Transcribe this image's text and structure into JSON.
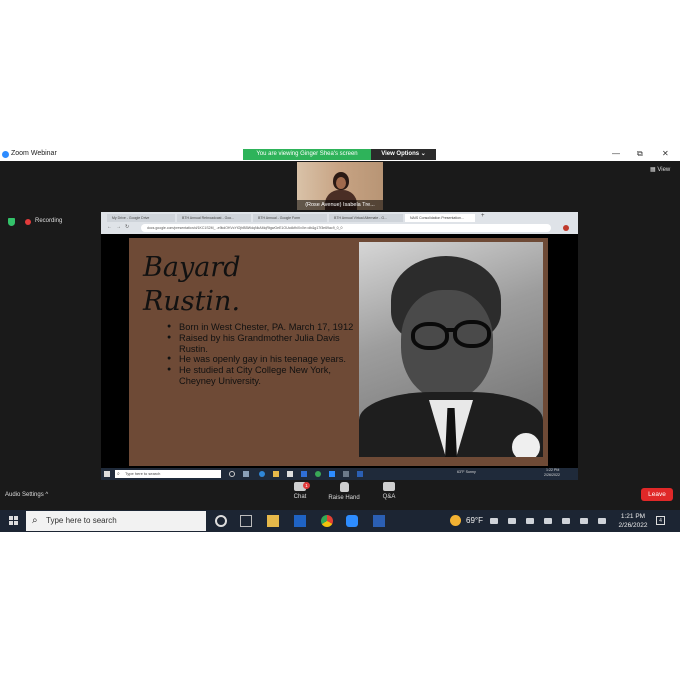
{
  "zoom": {
    "title": "Zoom Webinar",
    "banner": "You are viewing Ginger Shea's screen",
    "view_options": "View Options",
    "view_options_arrow": "⌄",
    "view_label": "View",
    "recording": "Recording",
    "participant_name": "(Rose Avenue) Isabela Tre...",
    "audio_settings": "Audio Settings",
    "audio_caret": "^",
    "controls": {
      "chat": "Chat",
      "chat_badge": "1",
      "raise_hand": "Raise Hand",
      "qa": "Q&A"
    },
    "leave": "Leave",
    "window_controls": {
      "minimize": "—",
      "restore": "⧉",
      "close": "✕"
    }
  },
  "browser": {
    "tabs": [
      "My Drive - Google Drive",
      "BTH Annual Rebroadcast - Goo...",
      "BTH Annual - Google Form",
      "BTH Annual Virtual Alternate - G...",
      "NAIS Consolidation Presentation..."
    ],
    "new_tab": "+",
    "url": "docs.google.com/presentation/d/1KC1S2M_ -e9kdOHVcYlOjhBBWdqNkAMqRtgwGeE1OUcdkfhiXxXe=db&g17f3e69ac9_0_0"
  },
  "slide": {
    "title_line1": "Bayard",
    "title_line2": "Rustin.",
    "bullets": [
      "Born in West Chester, PA. March 17, 1912",
      "Raised by his Grandmother Julia Davis Rustin.",
      "He was openly gay in his teenage years.",
      "He studied at City College New York, Cheyney University."
    ]
  },
  "inner_taskbar": {
    "search": "Type here to search",
    "weather": "63°F Sunny",
    "time": "1:22 PM",
    "date": "2/26/2022"
  },
  "taskbar": {
    "search_placeholder": "Type here to search",
    "temperature": "69°F",
    "time": "1:21 PM",
    "date": "2/26/2022",
    "notification_count": "4"
  },
  "colors": {
    "zoom_bg": "#1a1a1a",
    "banner_green": "#2eb35a",
    "leave_red": "#e02828",
    "slide_brown": "#6e4a36",
    "taskbar_bg": "#1c2533"
  }
}
